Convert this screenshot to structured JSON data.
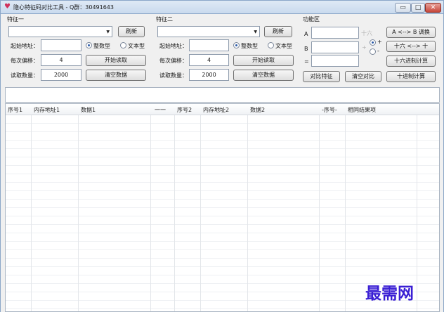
{
  "window": {
    "title": "隐心特征码对比工具 - Q群：30491643",
    "min_glyph": "▭",
    "max_glyph": "□",
    "close_glyph": "✕"
  },
  "group1": {
    "title": "特征一",
    "refresh": "刷新",
    "start_address_label": "起始地址：",
    "start_address_value": "",
    "radio_int": "整数型",
    "radio_text": "文本型",
    "offset_label": "每次偏移：",
    "offset_value": "4",
    "start_read": "开始读取",
    "read_count_label": "读取数量：",
    "read_count_value": "2000",
    "clear_data": "清空数据"
  },
  "group2": {
    "title": "特征二",
    "refresh": "刷新",
    "start_address_label": "起始地址：",
    "start_address_value": "",
    "radio_int": "整数型",
    "radio_text": "文本型",
    "offset_label": "每次偏移：",
    "offset_value": "4",
    "start_read": "开始读取",
    "read_count_label": "读取数量：",
    "read_count_value": "2000",
    "clear_data": "清空数据"
  },
  "func": {
    "title": "功能区",
    "label_a": "A",
    "label_b": "B",
    "label_eq": "=",
    "op_hex": "十六",
    "op_plus": "+",
    "radio_plus": "+",
    "radio_minus": "-",
    "swap_ab": "A <--> B 调换",
    "hex_dec": "十六 <--> 十",
    "hex_calc": "十六进制计算",
    "compare": "对比特征",
    "clear_compare": "清空对比",
    "dec_calc": "十进制计算"
  },
  "table": {
    "columns": [
      "序号1",
      "内存地址1",
      "数据1",
      "一一",
      "序号2",
      "内存地址2",
      "数据2",
      "-序号-",
      "相同结果项"
    ]
  },
  "watermark": "最需网"
}
